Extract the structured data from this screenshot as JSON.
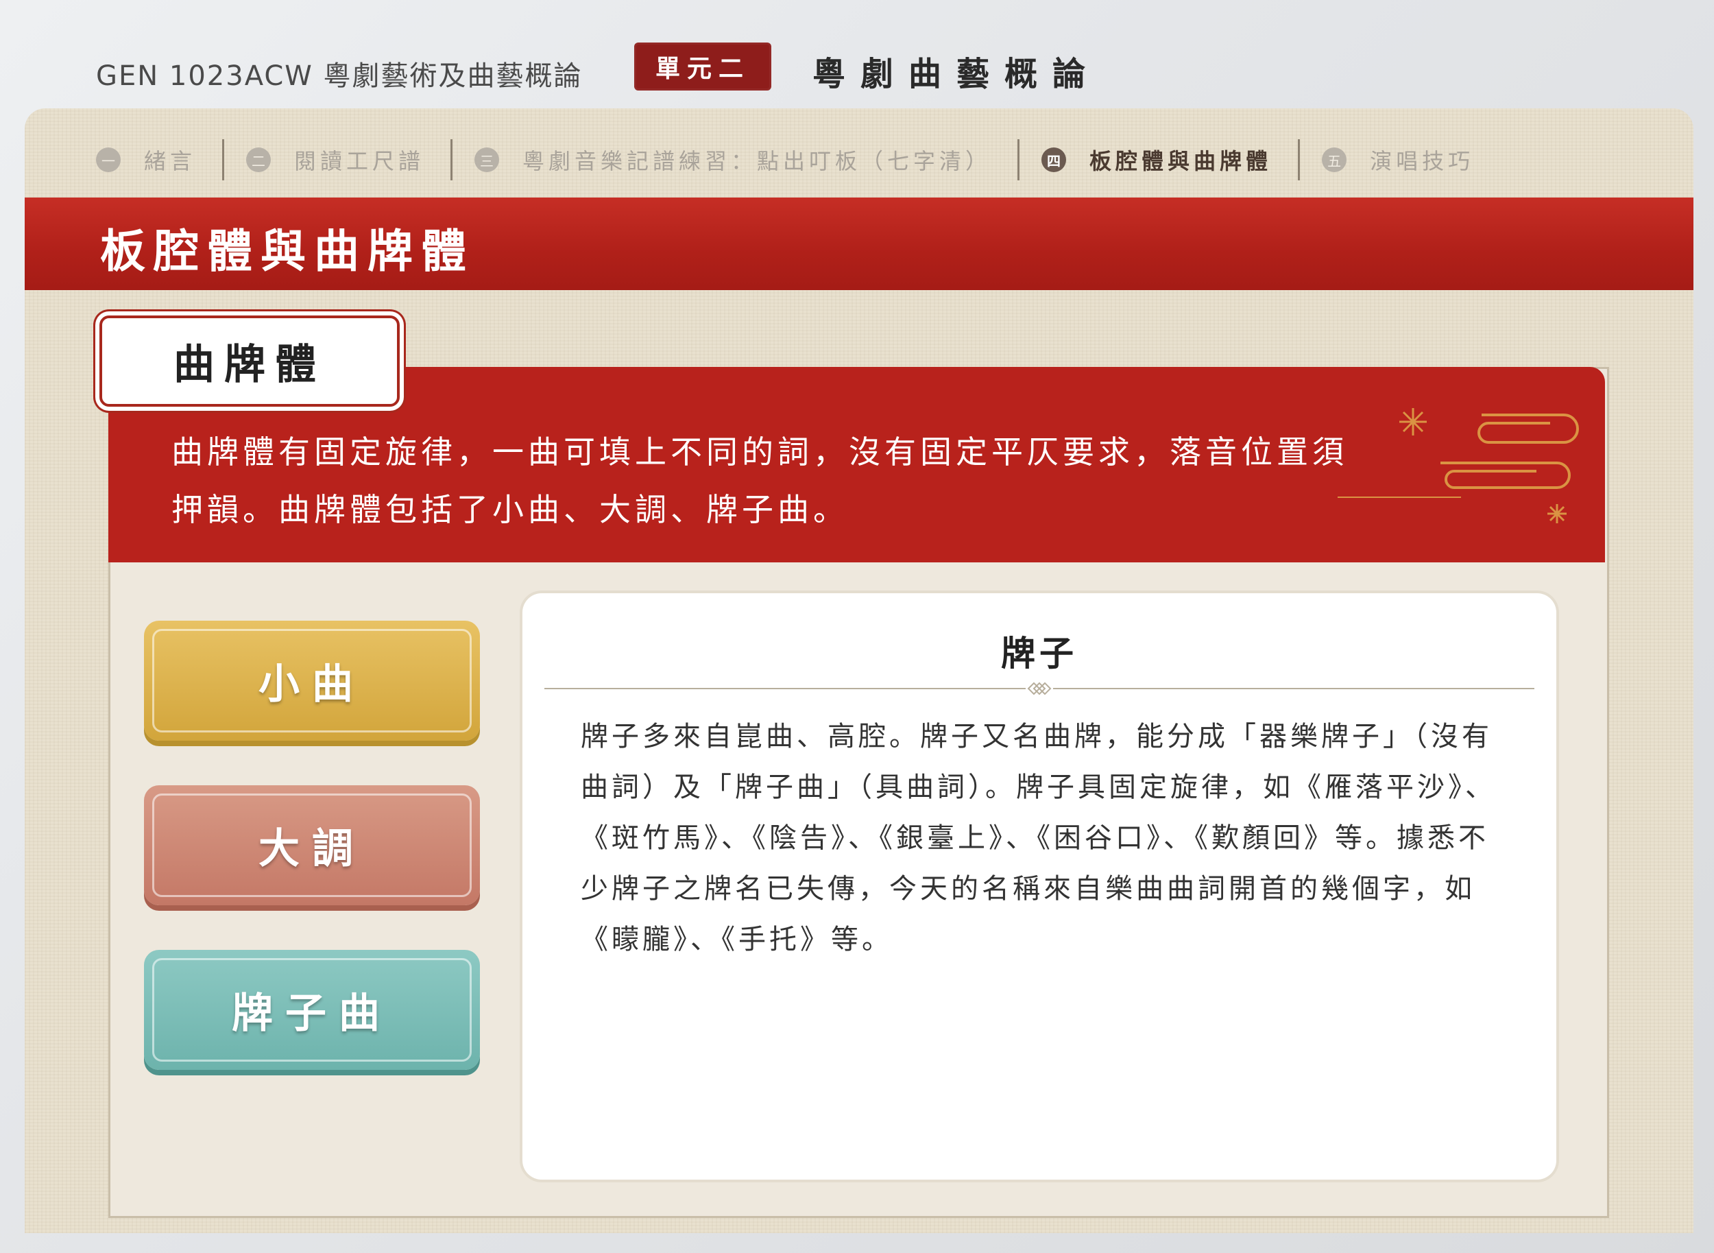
{
  "header": {
    "course_code": "GEN 1023ACW 粵劇藝術及曲藝概論",
    "unit_badge": "單元二",
    "unit_title": "粵劇曲藝概論"
  },
  "nav": {
    "tabs": [
      {
        "num": "一",
        "label": "緒言",
        "active": false
      },
      {
        "num": "二",
        "label": "閱讀工尺譜",
        "active": false
      },
      {
        "num": "三",
        "label": "粵劇音樂記譜練習：點出叮板（七字清）",
        "active": false
      },
      {
        "num": "四",
        "label": "板腔體與曲牌體",
        "active": true
      },
      {
        "num": "五",
        "label": "演唱技巧",
        "active": false
      }
    ]
  },
  "banner": {
    "title": "板腔體與曲牌體"
  },
  "section": {
    "tag": "曲牌體",
    "intro": "曲牌體有固定旋律，一曲可填上不同的詞，沒有固定平仄要求，落音位置須押韻。曲牌體包括了小曲、大調、牌子曲。"
  },
  "buttons": {
    "xiaoqu": "小曲",
    "dadiao": "大調",
    "paiziqu": "牌子曲"
  },
  "detail": {
    "title": "牌子",
    "body": "牌子多來自崑曲、高腔。牌子又名曲牌，能分成「器樂牌子」（沒有曲詞）及「牌子曲」（具曲詞）。牌子具固定旋律，如《雁落平沙》、《斑竹馬》、《陰告》、《銀臺上》、《困谷口》、《歎顏回》等。據悉不少牌子之牌名已失傳，今天的名稱來自樂曲曲詞開首的幾個字，如《矇朧》、《手托》等。"
  },
  "colors": {
    "banner_red": "#b02019",
    "xiaoqu_gold": "#d9b04a",
    "dadiao_rose": "#cc8572",
    "paiziqu_teal": "#7cbdb6"
  }
}
